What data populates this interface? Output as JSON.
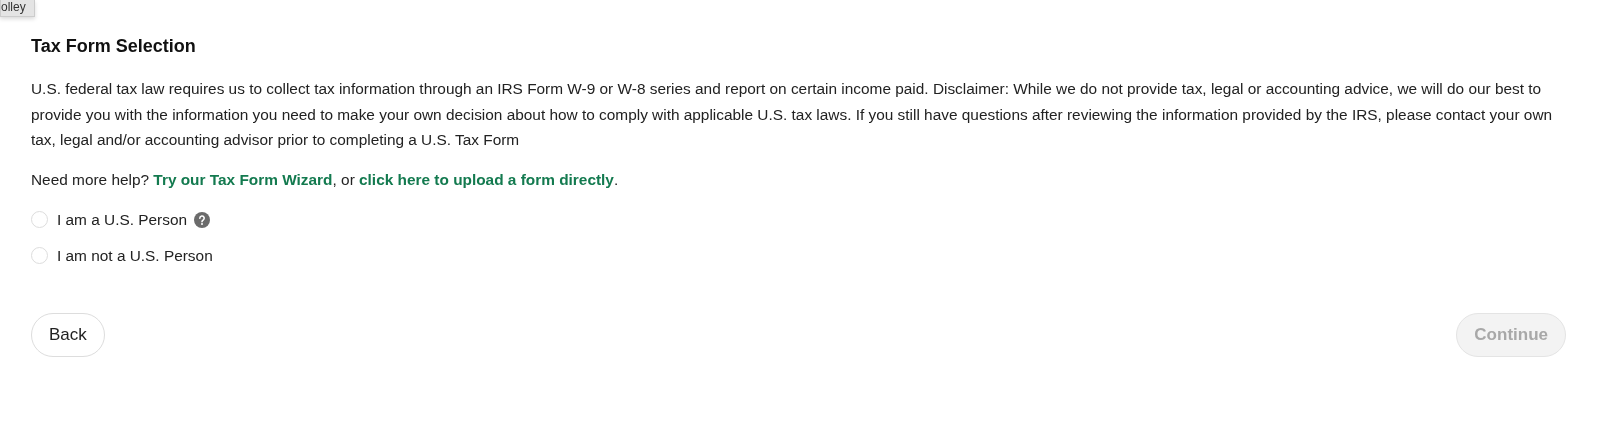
{
  "tooltip": "olley",
  "title": "Tax Form Selection",
  "description": "U.S. federal tax law requires us to collect tax information through an IRS Form W-9 or W-8 series and report on certain income paid. Disclaimer: While we do not provide tax, legal or accounting advice, we will do our best to provide you with the information you need to make your own decision about how to comply with applicable U.S. tax laws. If you still have questions after reviewing the information provided by the IRS, please contact your own tax, legal and/or accounting advisor prior to completing a U.S. Tax Form",
  "help": {
    "prefix": "Need more help?",
    "link1": "Try our Tax Form Wizard",
    "middle": ", or",
    "link2": "click here to upload a form directly",
    "suffix": "."
  },
  "options": [
    {
      "label": "I am a U.S. Person",
      "selected": false,
      "has_help": true
    },
    {
      "label": "I am not a U.S. Person",
      "selected": false,
      "has_help": false
    }
  ],
  "buttons": [
    {
      "label": "Back",
      "disabled": false
    },
    {
      "label": "Continue",
      "disabled": true
    }
  ]
}
